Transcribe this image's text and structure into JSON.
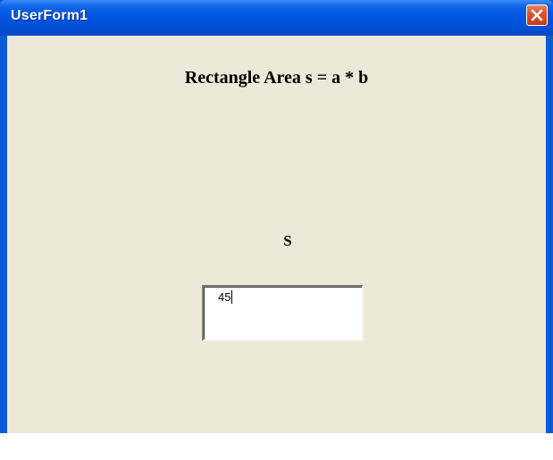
{
  "window": {
    "title": "UserForm1",
    "close_icon": "close-icon"
  },
  "form": {
    "heading": "Rectangle Area s = a * b",
    "result_label": "S",
    "result_value": "45"
  },
  "colors": {
    "titlebar": "#0055e1",
    "client_background": "#ece9d8",
    "close_button": "#d9552f"
  }
}
